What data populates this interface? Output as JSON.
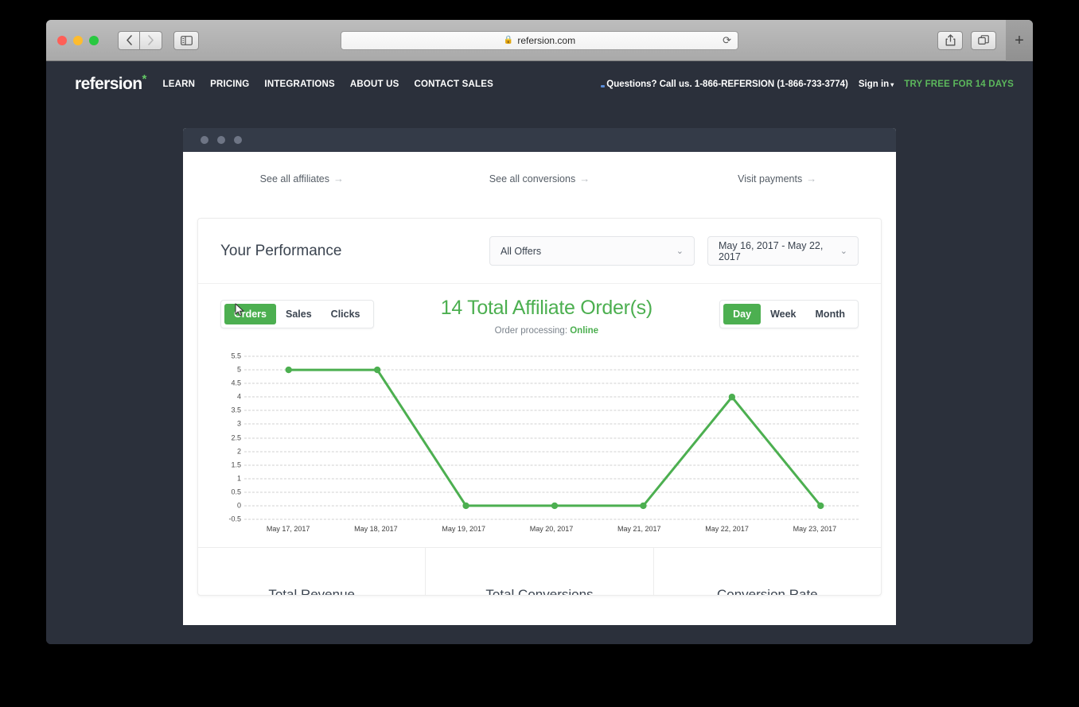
{
  "browser": {
    "url": "refersion.com",
    "lock_icon": "lock-icon",
    "reload_icon": "reload-icon",
    "back_icon": "chevron-left-icon",
    "forward_icon": "chevron-right-icon",
    "sidebar_icon": "sidebar-toggle-icon",
    "share_icon": "share-icon",
    "tabs_icon": "show-tabs-icon",
    "newtab_icon": "plus-icon"
  },
  "site_header": {
    "logo_text": "refersion",
    "logo_star": "*",
    "nav": [
      {
        "label": "LEARN"
      },
      {
        "label": "PRICING"
      },
      {
        "label": "INTEGRATIONS"
      },
      {
        "label": "ABOUT US"
      },
      {
        "label": "CONTACT SALES"
      }
    ],
    "questions": "Questions? Call us. 1-866-REFERSION (1-866-733-3774)",
    "signin": "Sign in",
    "signin_caret": "▾",
    "trial_cta": "TRY FREE FOR 14 DAYS"
  },
  "app": {
    "quicklinks": [
      {
        "label": "See all affiliates",
        "arrow": "→"
      },
      {
        "label": "See all conversions",
        "arrow": "→"
      },
      {
        "label": "Visit payments",
        "arrow": "→"
      }
    ],
    "card": {
      "title": "Your Performance",
      "offers_value": "All Offers",
      "date_value": "May 16, 2017 - May 22, 2017",
      "chevron": "⌄"
    },
    "metric_tabs": [
      {
        "label": "Orders",
        "active": true
      },
      {
        "label": "Sales",
        "active": false
      },
      {
        "label": "Clicks",
        "active": false
      }
    ],
    "interval_tabs": [
      {
        "label": "Day",
        "active": true
      },
      {
        "label": "Week",
        "active": false
      },
      {
        "label": "Month",
        "active": false
      }
    ],
    "headline": "14 Total Affiliate Order(s)",
    "sub_prefix": "Order processing:",
    "sub_status": "Online",
    "stats": [
      {
        "label": "Total Revenue"
      },
      {
        "label": "Total Conversions"
      },
      {
        "label": "Conversion Rate"
      }
    ]
  },
  "colors": {
    "brand_green": "#4caf50",
    "dark_navy": "#2b303b",
    "app_titlebar": "#343b48",
    "text_dark": "#3b4450"
  },
  "chart_data": {
    "type": "line",
    "title": "14 Total Affiliate Order(s)",
    "xlabel": "",
    "ylabel": "",
    "categories": [
      "May 17, 2017",
      "May 18, 2017",
      "May 19, 2017",
      "May 20, 2017",
      "May 21, 2017",
      "May 22, 2017",
      "May 23, 2017"
    ],
    "series": [
      {
        "name": "Orders",
        "values": [
          5,
          5,
          0,
          0,
          0,
          4,
          0
        ],
        "color": "#4caf50"
      }
    ],
    "ylim": [
      -0.5,
      5.5
    ],
    "yticks": [
      5.5,
      5,
      4.5,
      4,
      3.5,
      3,
      2.5,
      2,
      1.5,
      1,
      0.5,
      0,
      -0.5
    ],
    "ytick_labels": [
      "5.5",
      "5",
      "4.5",
      "4",
      "3.5",
      "3",
      "2.5",
      "2",
      "1.5",
      "1",
      "0.5",
      "0",
      "-0.5"
    ],
    "grid": true,
    "grid_style": "dashed",
    "legend": false,
    "markers": true
  }
}
